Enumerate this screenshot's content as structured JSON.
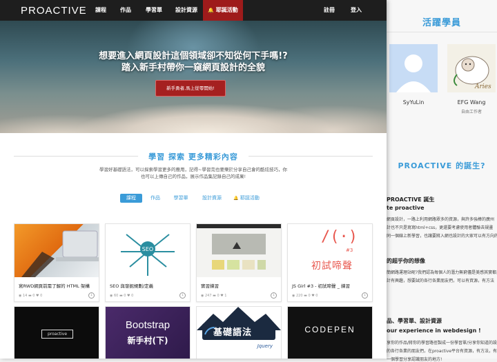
{
  "nav": {
    "logo": "PROACTIVE",
    "items": [
      "課程",
      "作品",
      "學習單",
      "設計資源",
      "耶誕活動"
    ],
    "highlight_icon": "bell-icon",
    "register": "註冊",
    "login": "登入"
  },
  "hero": {
    "line1": "想要進入網頁設計這個領域卻不知從何下手嗎!?",
    "line2": "踏入新手村帶你一窺網頁設計的全貌",
    "button": "新手勇者,馬上從零開始!"
  },
  "section": {
    "title": "學習 探索 更多精彩內容",
    "intro1": "學習好基礎語法，可以探索學習更多的應用，記得~學習完也要樂於分享自己會的酷炫技巧，你",
    "intro2": "也可以上傳自己的作品，展示作品集記錄自己的成果!"
  },
  "tabs": [
    "課程",
    "作品",
    "學習單",
    "設計資源",
    "耶誕活動"
  ],
  "cards": [
    {
      "title": "寫RWD網頁前需了解的 HTML 架構",
      "views": "14",
      "comments": "0",
      "likes": "0"
    },
    {
      "title": "SEO 與發掘規劃/定義",
      "views": "60",
      "comments": "0",
      "likes": "0"
    },
    {
      "title": "實習練習",
      "views": "247",
      "comments": "0",
      "likes": "1"
    },
    {
      "title": "JS Girl #3 - 初試啼聲 _ 練習",
      "views": "220",
      "comments": "0",
      "likes": "0"
    }
  ],
  "thumbs": {
    "seo_center": "SEO",
    "js_glyph": "/(·)",
    "js_num": "#3",
    "js_text": "初試啼聲",
    "proactive_tag": "proactive",
    "bootstrap1": "Bootstrap",
    "bootstrap2": "新手村(下)",
    "jquery_main": "基礎語法",
    "jquery_sub": "Jquery",
    "codepen": "CODEPEN"
  },
  "side": {
    "title": "活躍學員",
    "members": [
      {
        "name": "SyYuLin",
        "job": ""
      },
      {
        "name": "EFG Wang",
        "job": "自由工作者"
      }
    ],
    "birth_title": "PROACTIVE 的誕生?",
    "h1": "PROACTIVE 誕生",
    "h1b": "te proactive",
    "p1": "網頁設計，一路上利用網路眾多的資源，與許多強棒的廣州",
    "p2": "計也不只是寫寫html+css，更還要考慮使用者體驗去規畫",
    "p3": "同一個線上新學習，也讓要將入網也設計的大家可以有方向的學習",
    "h2": "的超乎你的想像",
    "p4": "簡網路運理站呢?我們認為每個人的潛力無窮儘是美感其實都是",
    "p5": "計有興趣，想要試的各行各業朋友們，可以有資源，有方法",
    "h3": "品、學習單、設計資源",
    "h3b": "our experience in webdesign !",
    "p6": "享你的作品/將你的學習路徑製成一份學習單/分享你知道的設",
    "p7": "的各行各業的朋友們，在proactive平台有資源，有方法，有",
    "p8": "一個學習分享認識朋友的地方!"
  },
  "colors": {
    "accent": "#3a9bd8",
    "nav_bg": "#1e1e1e",
    "nav_highlight": "#9e1b1b",
    "hero_button": "#a52020"
  }
}
